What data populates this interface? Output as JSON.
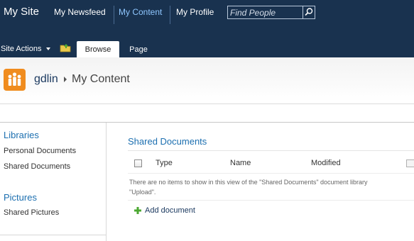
{
  "top_nav": {
    "site_title": "My Site",
    "links": [
      {
        "label": "My Newsfeed",
        "active": false
      },
      {
        "label": "My Content",
        "active": true
      },
      {
        "label": "My Profile",
        "active": false
      }
    ],
    "search_placeholder": "Find People"
  },
  "ribbon": {
    "site_actions_label": "Site Actions",
    "tabs": [
      {
        "label": "Browse",
        "selected": true
      },
      {
        "label": "Page",
        "selected": false
      }
    ]
  },
  "title_area": {
    "breadcrumb_user": "gdlin",
    "breadcrumb_current": "My Content"
  },
  "quick_launch": {
    "sections": [
      {
        "heading": "Libraries",
        "items": [
          "Personal Documents",
          "Shared Documents"
        ]
      },
      {
        "heading": "Pictures",
        "items": [
          "Shared Pictures"
        ]
      }
    ]
  },
  "main": {
    "web_part_title": "Shared Documents",
    "columns": [
      "Type",
      "Name",
      "Modified"
    ],
    "empty_message_line1": "There are no items to show in this view of the \"Shared Documents\" document library",
    "empty_message_line2": "\"Upload\".",
    "add_document_label": "Add document"
  },
  "colors": {
    "top_bar_bg": "#19324f",
    "active_link": "#8fc7ff",
    "heading_blue": "#1c6fb0",
    "logo_orange": "#f08c1e",
    "add_icon_green": "#4ca832"
  },
  "icons": {
    "search": "search-icon",
    "folder_up": "navigate-up-icon",
    "logo": "my-site-logo-icon",
    "add": "add-icon"
  }
}
